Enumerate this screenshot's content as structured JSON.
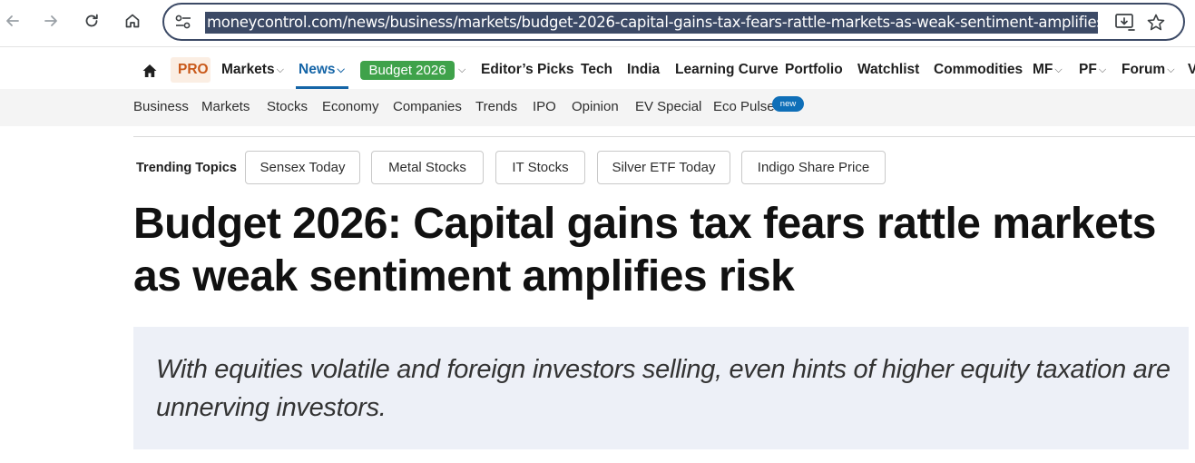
{
  "browser": {
    "url": "moneycontrol.com/news/business/markets/budget-2026-capital-gains-tax-fears-rattle-markets-as-weak-sentiment-amplifies-ris",
    "icons": [
      "back-icon",
      "forward-icon",
      "reload-icon",
      "home-icon",
      "site-settings-icon",
      "install-app-icon",
      "bookmark-star-icon"
    ]
  },
  "nav_primary": {
    "pro": "PRO",
    "markets": "Markets",
    "news": "News",
    "budget": "Budget 2026",
    "editors_picks": "Editor’s Picks",
    "tech": "Tech",
    "india": "India",
    "learning_curve": "Learning Curve",
    "portfolio": "Portfolio",
    "watchlist": "Watchlist",
    "commodities": "Commodities",
    "mf": "MF",
    "pf": "PF",
    "forum": "Forum",
    "overflow": "V"
  },
  "nav_secondary": {
    "items": [
      "Business",
      "Markets",
      "Stocks",
      "Economy",
      "Companies",
      "Trends",
      "IPO",
      "Opinion",
      "EV Special",
      "Eco Pulse"
    ],
    "new_badge": "new"
  },
  "trending": {
    "label": "Trending Topics",
    "topics": [
      "Sensex Today",
      "Metal Stocks",
      "IT Stocks",
      "Silver ETF Today",
      "Indigo Share Price"
    ]
  },
  "article": {
    "headline": "Budget 2026: Capital gains tax fears rattle markets as weak sentiment amplifies risk",
    "summary": "With equities volatile and foreign investors selling, even hints of higher equity taxation are unnerving investors."
  },
  "colors": {
    "url_highlight": "#3c4a66",
    "news_active": "#1565a7",
    "budget_pill": "#3fa24a",
    "pro_text": "#c9591a",
    "summary_bg": "#edf0f7"
  }
}
